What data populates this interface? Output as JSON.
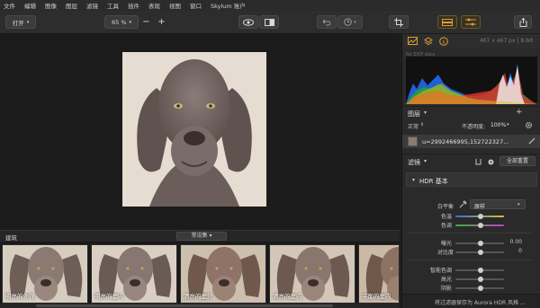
{
  "menubar": [
    "文件",
    "编辑",
    "图像",
    "图层",
    "滤镜",
    "工具",
    "插件",
    "表现",
    "视图",
    "窗口",
    "Skylum 账户"
  ],
  "toolbar": {
    "open_label": "打开",
    "zoom_value": "65 %",
    "accent": "#e0a030"
  },
  "canvas": {
    "photo_subject": "weimaraner dog portrait"
  },
  "filmstrip": {
    "title": "建筑",
    "preset_dropdown": "常设集",
    "thumbs": [
      "明亮的外观",
      "明亮的室内",
      "清亮的室外",
      "清亮的室内",
      "平衡的室内"
    ]
  },
  "panel": {
    "info": "467 x 467 px | 8-bit",
    "exif": "No EXIF data",
    "layers": {
      "title": "图层",
      "mode": "正常",
      "opacity_label": "不透明度:",
      "opacity_value": "100%",
      "layer_name": "u=2992466995,152722327..."
    },
    "filters": {
      "title": "滤镜",
      "reset_all": "全部重置",
      "section": "HDR 基本",
      "white_balance_label": "白平衡",
      "white_balance_value": "原样",
      "sliders": [
        {
          "label": "色温",
          "value": ""
        },
        {
          "label": "色调",
          "value": ""
        },
        {
          "label": "曝光",
          "value": "0.00"
        },
        {
          "label": "对比度",
          "value": "0"
        },
        {
          "label": "智能色调",
          "value": ""
        },
        {
          "label": "高光",
          "value": ""
        },
        {
          "label": "阴影",
          "value": ""
        }
      ],
      "footer": "将过滤器保存为 Aurora HDR 风格 ..."
    }
  }
}
